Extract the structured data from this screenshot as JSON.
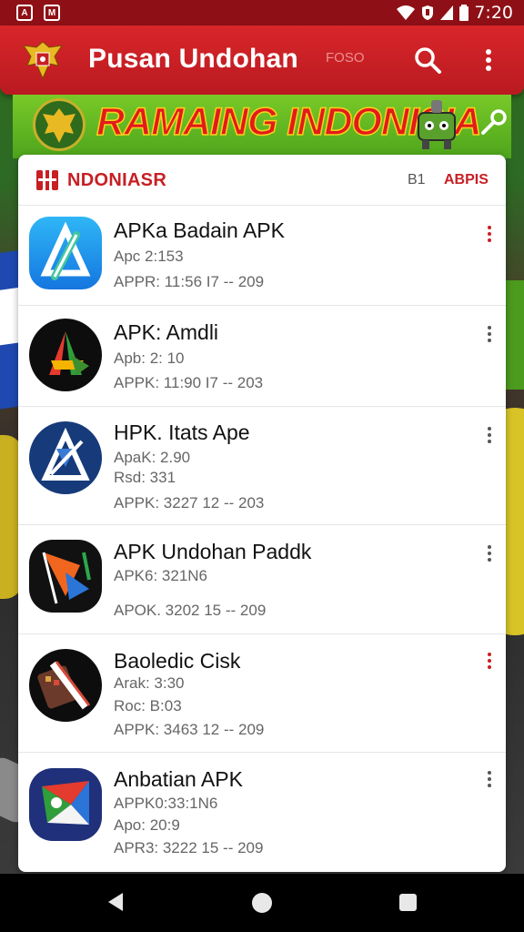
{
  "status_bar": {
    "time": "7:20",
    "left_icons": [
      "A",
      "M"
    ]
  },
  "app_bar": {
    "title": "Pusan Undohan",
    "chip": "FOSO"
  },
  "banner": {
    "title": "RAMAING INDONISIA"
  },
  "card_header": {
    "title": "NDONIASR",
    "count": "B1",
    "action": "ABPIS"
  },
  "apps": [
    {
      "title": "APKa Badain APK",
      "lines": [
        "Apc 2:153",
        "APPR: 11:56 I7 -- 209"
      ],
      "icon": "app-store-icon",
      "menu_color": "red"
    },
    {
      "title": "APK: Amdli",
      "lines": [
        "Apb: 2: 10",
        "APPK: 11:90 I7 -- 203"
      ],
      "icon": "multicolor-a-icon",
      "menu_color": "grey"
    },
    {
      "title": "HPK. Itats Ape",
      "lines": [
        "ApaK: 2.90",
        "Rsd: 331",
        "APPK: 3227 12 -- 203"
      ],
      "icon": "blue-a-icon",
      "menu_color": "grey"
    },
    {
      "title": "APK Undohan Paddk",
      "lines": [
        "APK6: 321N6",
        "APOK. 3202 15 -- 209"
      ],
      "icon": "orange-blue-shard-icon",
      "menu_color": "grey"
    },
    {
      "title": "Baoledic Cisk",
      "lines": [
        "Arak: 3:30",
        "Roc: B:03",
        "APPK: 3463 12 -- 209"
      ],
      "icon": "slash-keyboard-icon",
      "menu_color": "red"
    },
    {
      "title": "Anbatian APK",
      "lines": [
        "APPK0:33:1N6",
        "Apo: 20:9",
        "APR3: 3222 15 -- 209"
      ],
      "icon": "google-like-icon",
      "menu_color": "grey"
    }
  ]
}
